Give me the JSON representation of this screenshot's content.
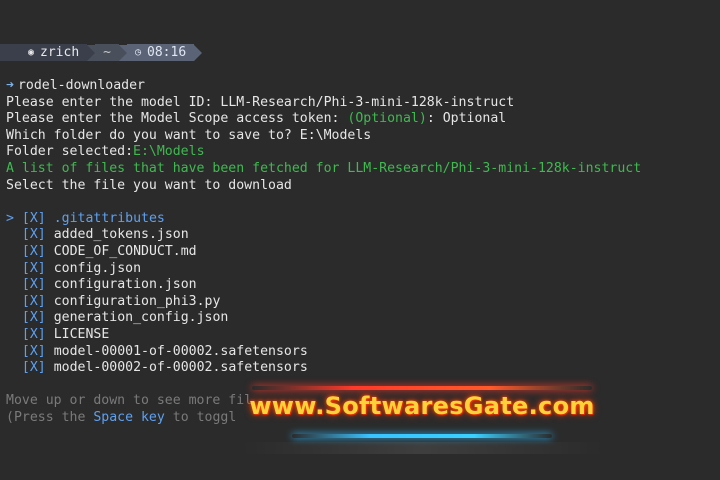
{
  "prompt": {
    "user": "zrich",
    "dir": "~",
    "time": "08:16"
  },
  "command": "rodel-downloader",
  "lines": {
    "model_id_prompt": "Please enter the model ID: ",
    "model_id_value": "LLM-Research/Phi-3-mini-128k-instruct",
    "token_prompt": "Please enter the Model Scope access token: ",
    "token_optional_hint": "(Optional)",
    "token_colon": ": ",
    "token_value": "Optional",
    "folder_prompt": "Which folder do you want to save to? ",
    "folder_value": "E:\\Models",
    "folder_selected_label": "Folder selected:",
    "folder_selected_value": "E:\\Models",
    "fetched_msg": "A list of files that have been fetched for LLM-Research/Phi-3-mini-128k-instruct",
    "select_msg": "Select the file you want to download"
  },
  "files": [
    {
      "name": ".gitattributes",
      "cursor": ">",
      "mark": "[X]",
      "selected": true
    },
    {
      "name": "added_tokens.json",
      "cursor": " ",
      "mark": "[X]",
      "selected": false
    },
    {
      "name": "CODE_OF_CONDUCT.md",
      "cursor": " ",
      "mark": "[X]",
      "selected": false
    },
    {
      "name": "config.json",
      "cursor": " ",
      "mark": "[X]",
      "selected": false
    },
    {
      "name": "configuration.json",
      "cursor": " ",
      "mark": "[X]",
      "selected": false
    },
    {
      "name": "configuration_phi3.py",
      "cursor": " ",
      "mark": "[X]",
      "selected": false
    },
    {
      "name": "generation_config.json",
      "cursor": " ",
      "mark": "[X]",
      "selected": false
    },
    {
      "name": "LICENSE",
      "cursor": " ",
      "mark": "[X]",
      "selected": false
    },
    {
      "name": "model-00001-of-00002.safetensors",
      "cursor": " ",
      "mark": "[X]",
      "selected": false
    },
    {
      "name": "model-00002-of-00002.safetensors",
      "cursor": " ",
      "mark": "[X]",
      "selected": false
    }
  ],
  "hints": {
    "more": "Move up or down to see more fil",
    "press_prefix": "(Press the ",
    "space_key": "Space key",
    "press_suffix": " to toggl"
  },
  "watermark": {
    "text": "www.SoftwaresGate.com"
  },
  "colors": {
    "background": "#2b2b2b",
    "green": "#3fb950",
    "blue": "#5ea0ef",
    "watermark": "#ffd23a"
  }
}
